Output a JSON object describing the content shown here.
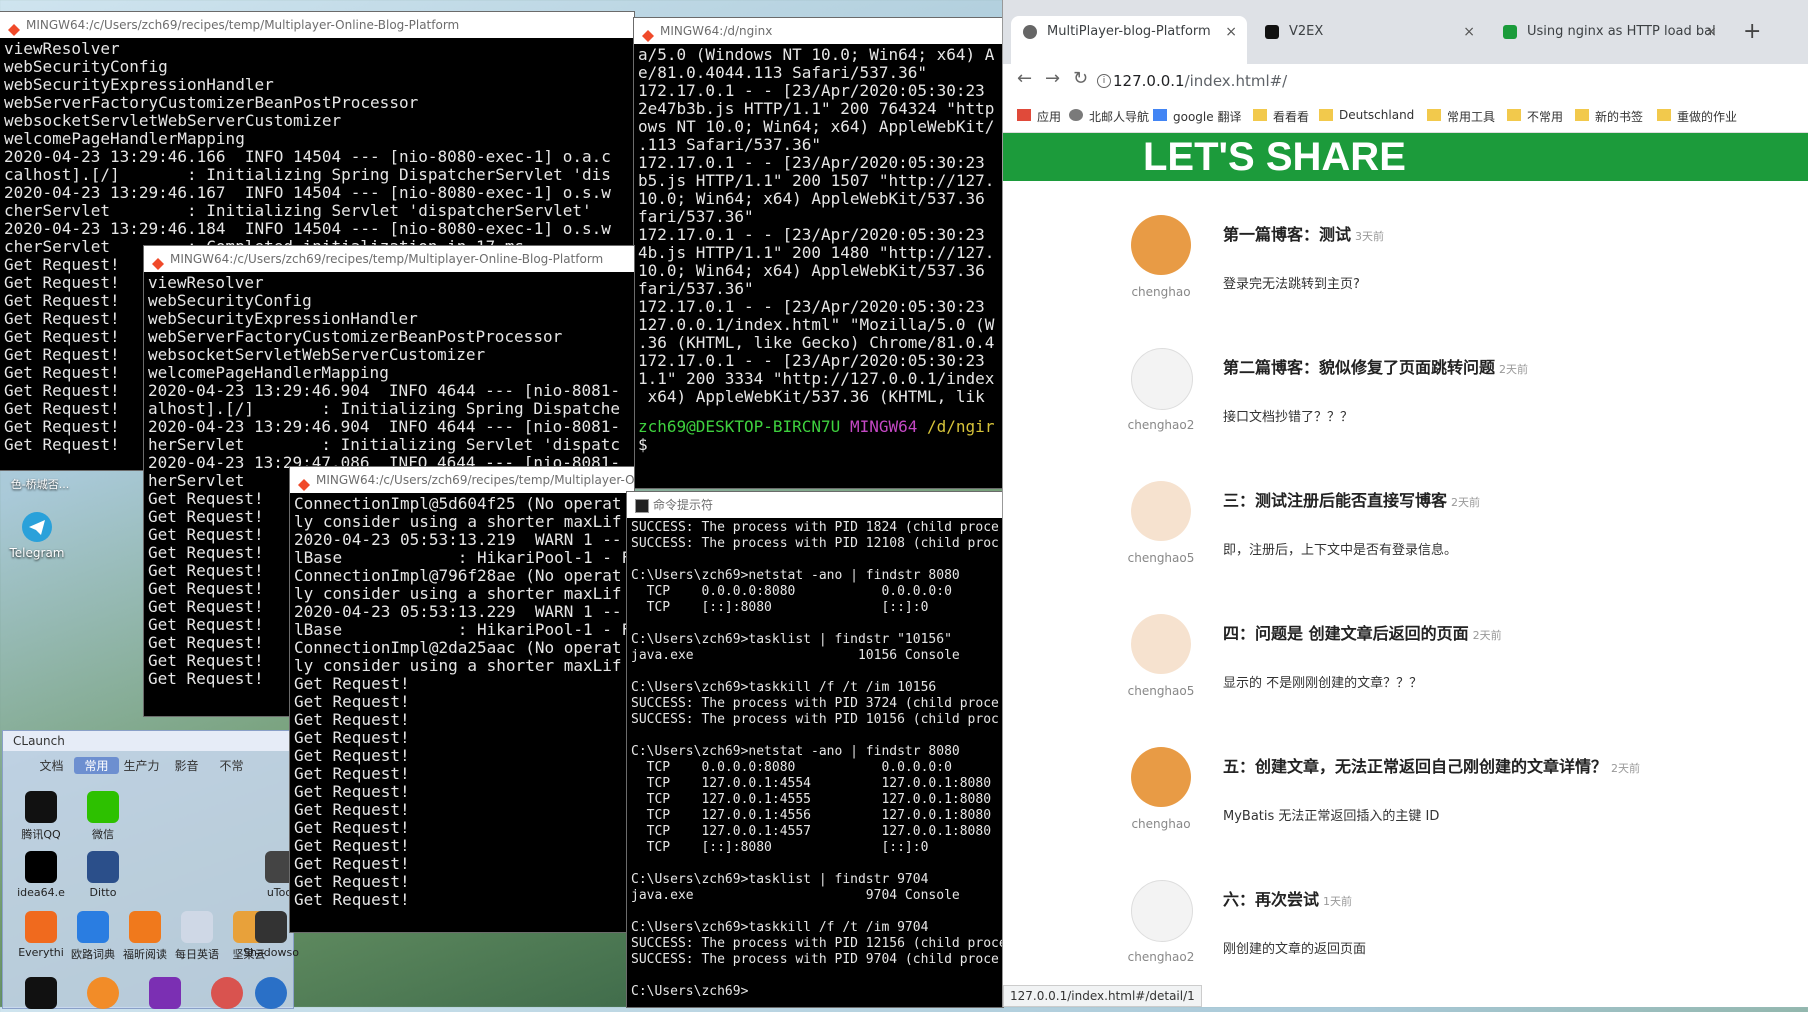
{
  "terminals": {
    "t1": {
      "title": "MINGW64:/c/Users/zch69/recipes/temp/Multiplayer-Online-Blog-Platform",
      "text": "viewResolver\nwebSecurityConfig\nwebSecurityExpressionHandler\nwebServerFactoryCustomizerBeanPostProcessor\nwebsocketServletWebServerCustomizer\nwelcomePageHandlerMapping\n2020-04-23 13:29:46.166  INFO 14504 --- [nio-8080-exec-1] o.a.c\ncalhost].[/]       : Initializing Spring DispatcherServlet 'dis\n2020-04-23 13:29:46.167  INFO 14504 --- [nio-8080-exec-1] o.s.w\ncherServlet        : Initializing Servlet 'dispatcherServlet'\n2020-04-23 13:29:46.184  INFO 14504 --- [nio-8080-exec-1] o.s.w\ncherServlet        : Completed initialization in 17 ms\nGet Request!\nGet Request!\nGet Request!\nGet Request!\nGet Request!\nGet Request!\nGet Request!\nGet Request!\nGet Request!\nGet Request!\nGet Request!"
    },
    "t2": {
      "title": "MINGW64:/d/nginx",
      "text": "a/5.0 (Windows NT 10.0; Win64; x64) A\ne/81.0.4044.113 Safari/537.36\"\n172.17.0.1 - - [23/Apr/2020:05:30:23\n2e47b3b.js HTTP/1.1\" 200 764324 \"http\nows NT 10.0; Win64; x64) AppleWebKit/\n.113 Safari/537.36\"\n172.17.0.1 - - [23/Apr/2020:05:30:23\nb5.js HTTP/1.1\" 200 1507 \"http://127.\n10.0; Win64; x64) AppleWebKit/537.36\nfari/537.36\"\n172.17.0.1 - - [23/Apr/2020:05:30:23\n4b.js HTTP/1.1\" 200 1480 \"http://127.\n10.0; Win64; x64) AppleWebKit/537.36\nfari/537.36\"\n172.17.0.1 - - [23/Apr/2020:05:30:23\n127.0.0.1/index.html\" \"Mozilla/5.0 (W\n.36 (KHTML, like Gecko) Chrome/81.0.4\n172.17.0.1 - - [23/Apr/2020:05:30:23\n1.1\" 200 3334 \"http://127.0.0.1/index\n x64) AppleWebKit/537.36 (KHTML, lik",
      "prompt_user": "zch69@DESKTOP-BIRCN7U",
      "prompt_shell": "MINGW64",
      "prompt_path": "/d/ngir",
      "prompt_symbol": "$"
    },
    "t3": {
      "title": "MINGW64:/c/Users/zch69/recipes/temp/Multiplayer-Online-Blog-Platform",
      "text": "viewResolver\nwebSecurityConfig\nwebSecurityExpressionHandler\nwebServerFactoryCustomizerBeanPostProcessor\nwebsocketServletWebServerCustomizer\nwelcomePageHandlerMapping\n2020-04-23 13:29:46.904  INFO 4644 --- [nio-8081-\nalhost].[/]       : Initializing Spring Dispatche\n2020-04-23 13:29:46.904  INFO 4644 --- [nio-8081-\nherServlet        : Initializing Servlet 'dispatc\n2020-04-23 13:29:47.086  INFO 4644 --- [nio-8081-\nherServlet\nGet Request!\nGet Request!\nGet Request!\nGet Request!\nGet Request!\nGet Request!\nGet Request!\nGet Request!\nGet Request!\nGet Request!\nGet Request!"
    },
    "t4": {
      "title": "MINGW64:/c/Users/zch69/recipes/temp/Multiplayer-Online-Blog-Platform",
      "text": "ConnectionImpl@5d604f25 (No operat\nly consider using a shorter maxLif\n2020-04-23 05:53:13.219  WARN 1 --\nlBase            : HikariPool-1 - Fa\nConnectionImpl@796f28ae (No operat\nly consider using a shorter maxLif\n2020-04-23 05:53:13.229  WARN 1 --\nlBase            : HikariPool-1 - Fa\nConnectionImpl@2da25aac (No operat\nly consider using a shorter maxLif\nGet Request!\nGet Request!\nGet Request!\nGet Request!\nGet Request!\nGet Request!\nGet Request!\nGet Request!\nGet Request!\nGet Request!\nGet Request!\nGet Request!\nGet Request!"
    },
    "t5": {
      "title": "命令提示符",
      "text": "SUCCESS: The process with PID 1824 (child proce\nSUCCESS: The process with PID 12108 (child proc\n\nC:\\Users\\zch69>netstat -ano | findstr 8080\n  TCP    0.0.0.0:8080           0.0.0.0:0\n  TCP    [::]:8080              [::]:0\n\nC:\\Users\\zch69>tasklist | findstr \"10156\"\njava.exe                     10156 Console\n\nC:\\Users\\zch69>taskkill /f /t /im 10156\nSUCCESS: The process with PID 3724 (child proce\nSUCCESS: The process with PID 10156 (child proc\n\nC:\\Users\\zch69>netstat -ano | findstr 8080\n  TCP    0.0.0.0:8080           0.0.0.0:0\n  TCP    127.0.0.1:4554         127.0.0.1:8080\n  TCP    127.0.0.1:4555         127.0.0.1:8080\n  TCP    127.0.0.1:4556         127.0.0.1:8080\n  TCP    127.0.0.1:4557         127.0.0.1:8080\n  TCP    [::]:8080              [::]:0\n\nC:\\Users\\zch69>tasklist | findstr 9704\njava.exe                      9704 Console\n\nC:\\Users\\zch69>taskkill /f /t /im 9704\nSUCCESS: The process with PID 12156 (child proce\nSUCCESS: The process with PID 9704 (child proce\n\nC:\\Users\\zch69>"
    }
  },
  "desktop": {
    "telegram_label": "Telegram",
    "partial_label": "色-桥城否..."
  },
  "clauncher": {
    "title": "CLaunch",
    "tabs": [
      "文档",
      "常用",
      "生产力",
      "影音",
      "不常"
    ],
    "items": [
      {
        "label": "腾讯QQ",
        "color": "#111111"
      },
      {
        "label": "微信",
        "color": "#2dc100"
      },
      {
        "label": "idea64.e",
        "color": "#000000"
      },
      {
        "label": "Ditto",
        "color": "#2b4f8a"
      },
      {
        "label": "uTool",
        "color": "#444444"
      },
      {
        "label": "Everythi",
        "color": "#f06a1e"
      },
      {
        "label": "欧路词典",
        "color": "#2a7de1"
      },
      {
        "label": "福昕阅读",
        "color": "#f0791c"
      },
      {
        "label": "每日英语",
        "color": "#cfd8e6"
      },
      {
        "label": "坚果云",
        "color": "#e8a13a"
      },
      {
        "label": "Shadowso",
        "color": "#333333"
      }
    ]
  },
  "browser": {
    "tabs": [
      {
        "title": "MultiPlayer-blog-Platform",
        "fav_color": "#555555",
        "close": "×"
      },
      {
        "title": "V2EX",
        "fav_color": "#111111",
        "close": "×"
      },
      {
        "title": "Using nginx as HTTP load bal",
        "fav_color": "#1a9b3a",
        "close": "×"
      }
    ],
    "new_tab": "+",
    "url_host": "127.0.0.1",
    "url_rest": "/index.html#/",
    "bookmarks": [
      {
        "label": "应用",
        "color": "#e04a3a"
      },
      {
        "label": "北邮人导航",
        "color": "#7a7a7a"
      },
      {
        "label": "google 翻译",
        "color": "#4285f4"
      },
      {
        "label": "看看看",
        "color": "#f2c94c"
      },
      {
        "label": "Deutschland",
        "color": "#f2c94c"
      },
      {
        "label": "常用工具",
        "color": "#f2c94c"
      },
      {
        "label": "不常用",
        "color": "#f2c94c"
      },
      {
        "label": "新的书签",
        "color": "#f2c94c"
      },
      {
        "label": "重做的作业",
        "color": "#f2c94c"
      }
    ],
    "banner_title": "LET'S SHARE",
    "posts": [
      {
        "author": "chenghao",
        "title": "第一篇博客：测试",
        "time": "3天前",
        "body": "登录完无法跳转到主页?",
        "avatar_color": "#e89b45"
      },
      {
        "author": "chenghao2",
        "title": "第二篇博客：貌似修复了页面跳转问题",
        "time": "2天前",
        "body": "接口文档抄错了？？？",
        "avatar_color": "#f3f3f3"
      },
      {
        "author": "chenghao5",
        "title": "三：测试注册后能否直接写博客",
        "time": "2天前",
        "body": "即，注册后，上下文中是否有登录信息。",
        "avatar_color": "#f6e2cf"
      },
      {
        "author": "chenghao5",
        "title": "四：问题是 创建文章后返回的页面",
        "time": "2天前",
        "body": "显示的 不是刚刚创建的文章？？？",
        "avatar_color": "#f6e2cf"
      },
      {
        "author": "chenghao",
        "title": "五：创建文章，无法正常返回自己刚创建的文章详情？",
        "time": "2天前",
        "body": "MyBatis 无法正常返回插入的主键 ID",
        "avatar_color": "#e89b45"
      },
      {
        "author": "chenghao2",
        "title": "六：再次尝试",
        "time": "1天前",
        "body": "刚创建的文章的返回页面",
        "avatar_color": "#f3f3f3"
      }
    ],
    "status_url": "127.0.0.1/index.html#/detail/1"
  },
  "colors": {
    "banner": "#1c9b3b",
    "prompt_user": "#3ed13e",
    "prompt_shell": "#c448c4",
    "prompt_path": "#d6c33a"
  }
}
